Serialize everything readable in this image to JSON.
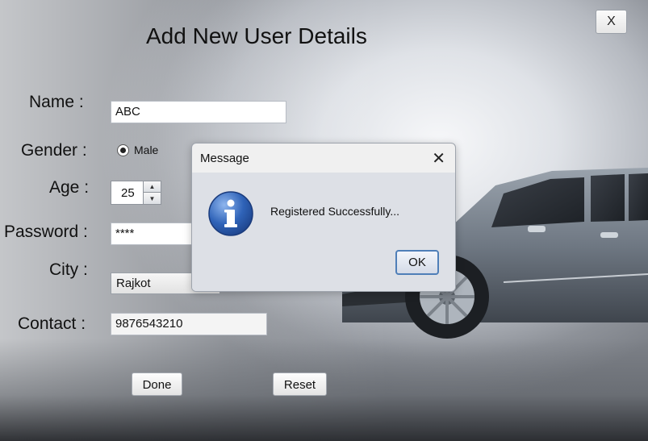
{
  "window": {
    "close_label": "X",
    "title": "Add New User Details"
  },
  "form": {
    "name_label": "Name :",
    "name_value": "ABC",
    "gender_label": "Gender :",
    "gender_option": "Male",
    "age_label": "Age :",
    "age_value": "25",
    "password_label": "Password :",
    "password_value": "****",
    "city_label": "City :",
    "city_value": "Rajkot",
    "contact_label": "Contact :",
    "contact_value": "9876543210",
    "done_label": "Done",
    "reset_label": "Reset"
  },
  "dialog": {
    "title": "Message",
    "close_glyph": "✕",
    "message": "Registered Successfully...",
    "ok_label": "OK",
    "icon": "info-icon"
  },
  "colors": {
    "dialog_ok_border": "#4f7fb8",
    "info_icon_blue": "#2f63b8"
  }
}
